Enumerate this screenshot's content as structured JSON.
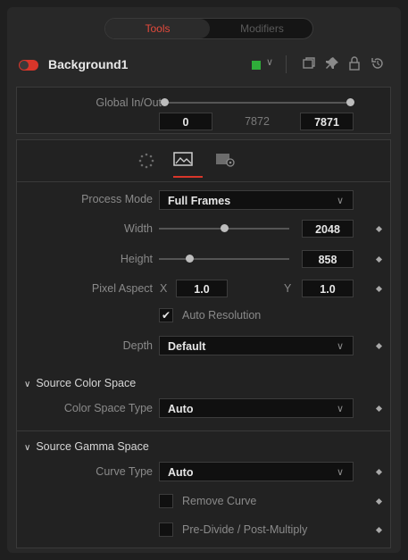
{
  "tabs": {
    "active": "Tools",
    "inactive": "Modifiers"
  },
  "tool": {
    "name": "Background1",
    "color": "#2fae3a"
  },
  "global_inout": {
    "label": "Global In/Out",
    "start": "0",
    "middle": "7872",
    "end": "7871"
  },
  "image_tab": {
    "process_mode_label": "Process Mode",
    "process_mode_value": "Full Frames",
    "width_label": "Width",
    "width_value": "2048",
    "width_slider_fraction": 0.47,
    "height_label": "Height",
    "height_value": "858",
    "height_slider_fraction": 0.22,
    "pixel_aspect_label": "Pixel Aspect",
    "x_label": "X",
    "x_value": "1.0",
    "y_label": "Y",
    "y_value": "1.0",
    "auto_resolution_label": "Auto Resolution",
    "auto_resolution_checked": true,
    "depth_label": "Depth",
    "depth_value": "Default"
  },
  "source_color_space": {
    "title": "Source Color Space",
    "type_label": "Color Space Type",
    "type_value": "Auto"
  },
  "source_gamma_space": {
    "title": "Source Gamma Space",
    "curve_label": "Curve Type",
    "curve_value": "Auto",
    "remove_curve_label": "Remove Curve",
    "predivide_label": "Pre-Divide / Post-Multiply"
  }
}
